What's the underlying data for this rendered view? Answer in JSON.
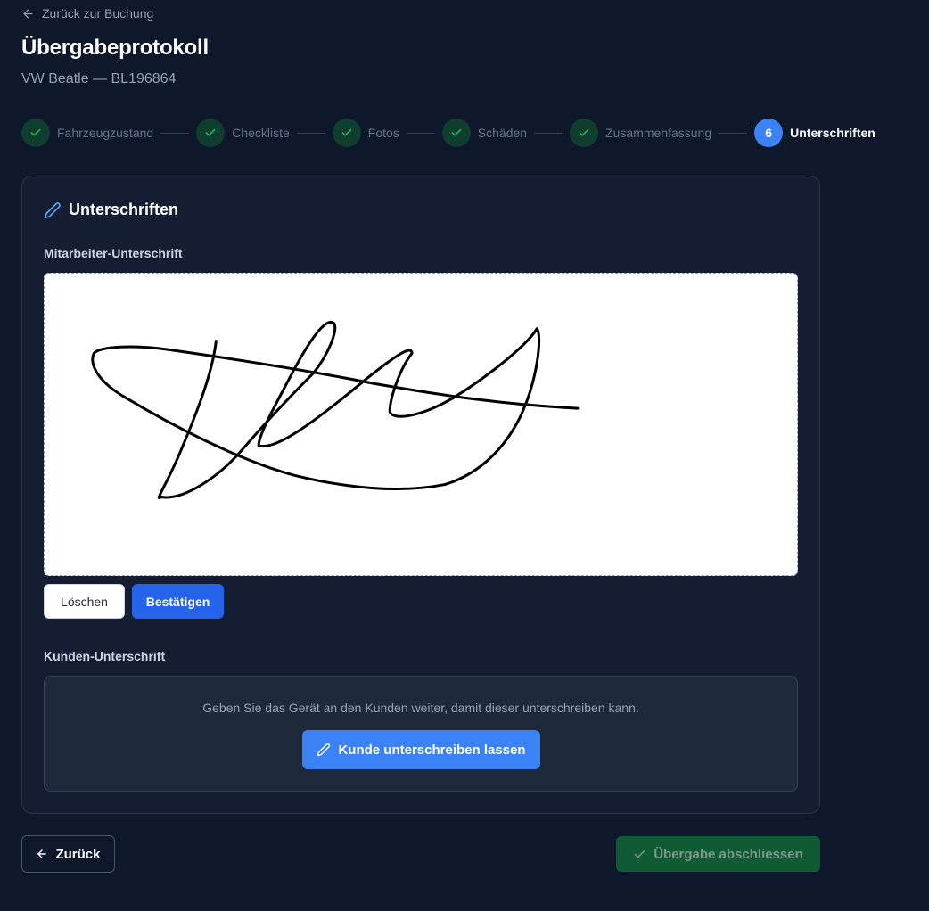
{
  "nav": {
    "back_link_label": "Zurück zur Buchung"
  },
  "header": {
    "title": "Übergabeprotokoll",
    "subtitle": "VW Beatle — BL196864"
  },
  "stepper": {
    "steps": [
      {
        "label": "Fahrzeugzustand",
        "status": "done",
        "number": "1"
      },
      {
        "label": "Checkliste",
        "status": "done",
        "number": "2"
      },
      {
        "label": "Fotos",
        "status": "done",
        "number": "3"
      },
      {
        "label": "Schäden",
        "status": "done",
        "number": "4"
      },
      {
        "label": "Zusammenfassung",
        "status": "done",
        "number": "5"
      },
      {
        "label": "Unterschriften",
        "status": "active",
        "number": "6"
      }
    ]
  },
  "signatures": {
    "title": "Unterschriften",
    "employee": {
      "label": "Mitarbeiter-Unterschrift",
      "clear_label": "Löschen",
      "confirm_label": "Bestätigen"
    },
    "customer": {
      "label": "Kunden-Unterschrift",
      "hint": "Geben Sie das Gerät an den Kunden weiter, damit dieser unterschreiben kann.",
      "button_label": "Kunde unterschreiben lassen"
    }
  },
  "footer": {
    "back_label": "Zurück",
    "finish_label": "Übergabe abschliessen"
  },
  "colors": {
    "background": "#0f172a",
    "card": "#141d31",
    "primary": "#3b82f6",
    "primary_dark": "#2563eb",
    "success_bg": "#0f3d2e",
    "success_check": "#22c55e",
    "finish_bg": "#0f5b34"
  },
  "icons": {
    "back": "arrow-left-icon",
    "done_step": "check-icon",
    "section": "pencil-icon",
    "finish": "check-icon"
  }
}
